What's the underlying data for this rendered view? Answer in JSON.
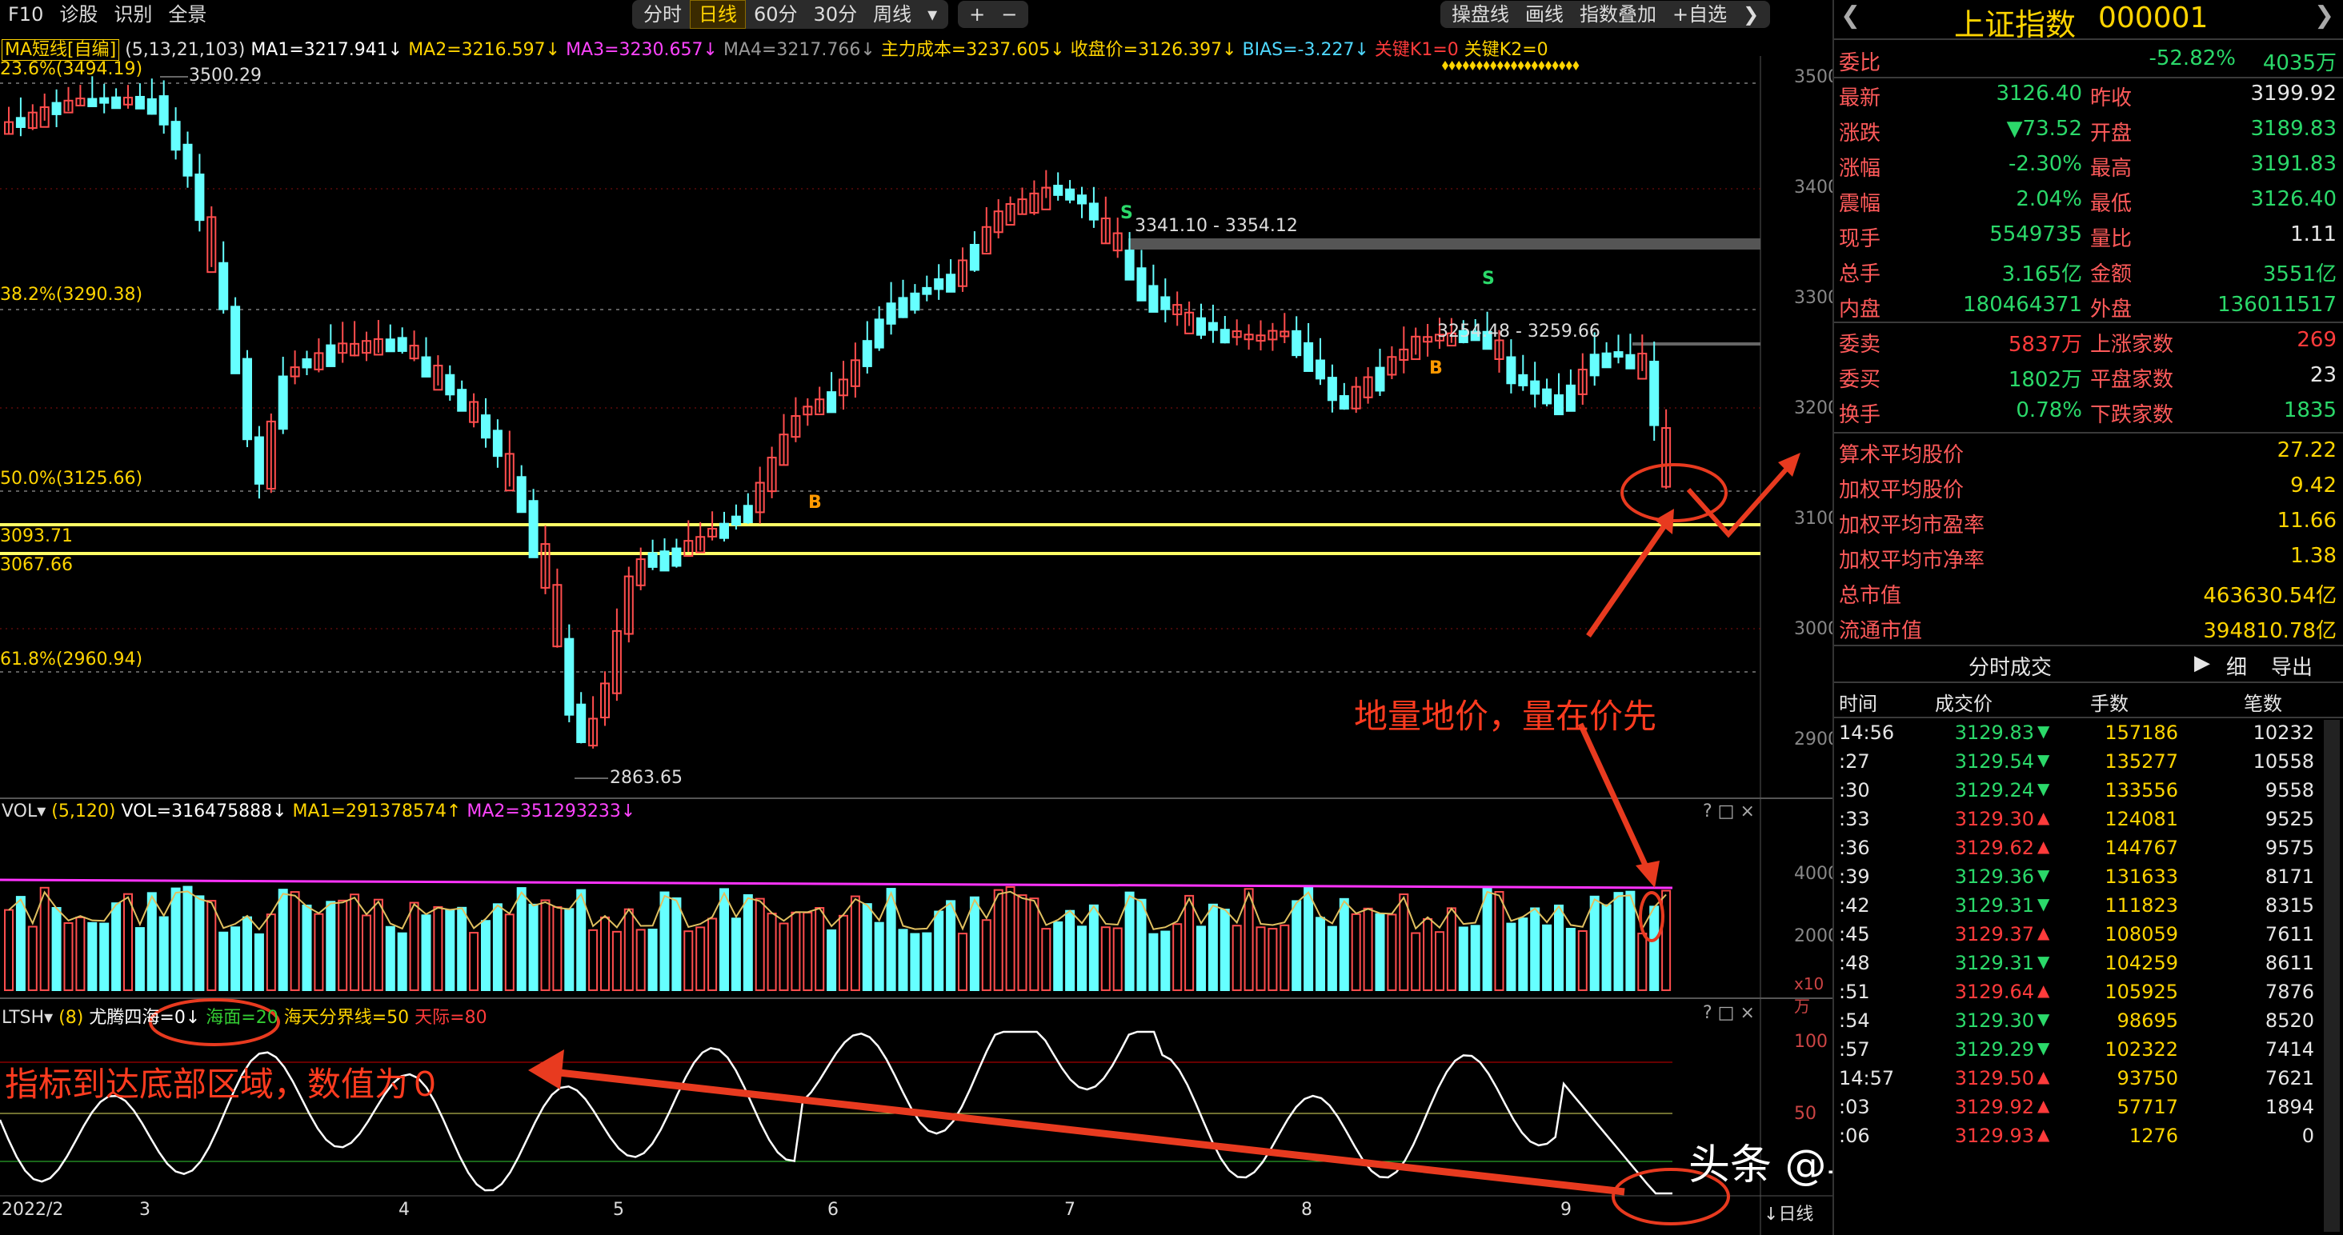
{
  "toolbar": {
    "f10": "F10",
    "diagnose": "诊股",
    "identify": "识别",
    "full": "全景",
    "period_tabs": [
      "分时",
      "日线",
      "60分",
      "30分",
      "周线"
    ],
    "period_active": "日线",
    "plus": "+",
    "minus": "−",
    "draw_line": "操盘线",
    "draw": "画线",
    "index_overlay": "指数叠加",
    "self_select": "+自选"
  },
  "main_legend": {
    "ma_type": "MA短线[自编]",
    "params": "(5,13,21,103)",
    "ma1": "MA1=3217.941↓",
    "ma2": "MA2=3216.597↓",
    "ma3": "MA3=3230.657↓",
    "ma4": "MA4=3217.766↓",
    "cost": "主力成本=3237.605↓",
    "close": "收盘价=3126.397↓",
    "bias": "BIAS=-3.227↓",
    "k1": "关键K1=0",
    "k2": "关键K2=0"
  },
  "price_labels": {
    "fib236": "23.6%(3494.19)",
    "high": "3500.29",
    "fib382": "38.2%(3290.38)",
    "fib50": "50.0%(3125.66)",
    "l1": "3093.71",
    "l2": "3067.66",
    "fib618": "61.8%(2960.94)",
    "low": "2863.65",
    "range1": "3341.10 - 3354.12",
    "range2": "3254.48 - 3259.66"
  },
  "signals": {
    "s": "S",
    "b": "B"
  },
  "price_axis": [
    "3500",
    "3400",
    "3300",
    "3200",
    "3100",
    "3000",
    "2900"
  ],
  "vol_legend": {
    "name": "VOL▾",
    "params": "(5,120)",
    "vol": "VOL=316475888↓",
    "ma1": "MA1=291378574↑",
    "ma2": "MA2=351293233↓"
  },
  "vol_axis": [
    "4000",
    "2000"
  ],
  "vol_unit": "x10万",
  "ind_legend": {
    "name": "LTSH▾",
    "params": "(8)",
    "a": "尤腾四海=0↓",
    "b": "海面=20",
    "c": "海天分界线=50",
    "d": "天际=80"
  },
  "ind_axis": [
    "100",
    "50"
  ],
  "x_axis": [
    "2022/2",
    "3",
    "4",
    "5",
    "6",
    "7",
    "8",
    "9"
  ],
  "period_btn": "↓日线",
  "panel_btns": "? □ ×",
  "annotations": {
    "price_note": "地量地价，量在价先",
    "indicator_note": "指标到达底部区域，数值为０",
    "watermark": "头条 @乌龟狂奔追蜗牛"
  },
  "side": {
    "title": "上证指数",
    "code": "000001",
    "weibi_label": "委比",
    "weibi": "-52.82%",
    "weicha": "4035万",
    "rows_left": [
      {
        "label": "最新",
        "value": "3126.40"
      },
      {
        "label": "涨跌",
        "value": "▼73.52"
      },
      {
        "label": "涨幅",
        "value": "-2.30%"
      },
      {
        "label": "震幅",
        "value": "2.04%"
      },
      {
        "label": "现手",
        "value": "5549735"
      },
      {
        "label": "总手",
        "value": "3.165亿"
      },
      {
        "label": "内盘",
        "value": "180464371"
      }
    ],
    "rows_right": [
      {
        "label": "昨收",
        "value": "3199.92"
      },
      {
        "label": "开盘",
        "value": "3189.83"
      },
      {
        "label": "最高",
        "value": "3191.83"
      },
      {
        "label": "最低",
        "value": "3126.40"
      },
      {
        "label": "量比",
        "value": "1.11"
      },
      {
        "label": "金额",
        "value": "3551亿"
      },
      {
        "label": "外盘",
        "value": "136011517"
      }
    ],
    "rows2_left": [
      {
        "label": "委卖",
        "value": "5837万"
      },
      {
        "label": "委买",
        "value": "1802万"
      },
      {
        "label": "换手",
        "value": "0.78%"
      }
    ],
    "rows2_right": [
      {
        "label": "上涨家数",
        "value": "269"
      },
      {
        "label": "平盘家数",
        "value": "23"
      },
      {
        "label": "下跌家数",
        "value": "1835"
      }
    ],
    "stats": [
      {
        "label": "算术平均股价",
        "value": "27.22"
      },
      {
        "label": "加权平均股价",
        "value": "9.42"
      },
      {
        "label": "加权平均市盈率",
        "value": "11.66"
      },
      {
        "label": "加权平均市净率",
        "value": "1.38"
      },
      {
        "label": "总市值",
        "value": "463630.54亿"
      },
      {
        "label": "流通市值",
        "value": "394810.78亿"
      }
    ],
    "trades_title": "分时成交",
    "trades_btn_detail": "细",
    "trades_btn_export": "导出",
    "trade_headers": [
      "时间",
      "成交价",
      "手数",
      "笔数"
    ],
    "trades": [
      {
        "t": "14:56",
        "p": "3129.83",
        "d": "▼",
        "v": "157186",
        "n": "10232"
      },
      {
        "t": ":27",
        "p": "3129.54",
        "d": "▼",
        "v": "135277",
        "n": "10558"
      },
      {
        "t": ":30",
        "p": "3129.24",
        "d": "▼",
        "v": "133556",
        "n": "9558"
      },
      {
        "t": ":33",
        "p": "3129.30",
        "d": "▲",
        "v": "124081",
        "n": "9525"
      },
      {
        "t": ":36",
        "p": "3129.62",
        "d": "▲",
        "v": "144767",
        "n": "9575"
      },
      {
        "t": ":39",
        "p": "3129.36",
        "d": "▼",
        "v": "131633",
        "n": "8171"
      },
      {
        "t": ":42",
        "p": "3129.31",
        "d": "▼",
        "v": "111823",
        "n": "8315"
      },
      {
        "t": ":45",
        "p": "3129.37",
        "d": "▲",
        "v": "108059",
        "n": "7611"
      },
      {
        "t": ":48",
        "p": "3129.31",
        "d": "▼",
        "v": "104259",
        "n": "8611"
      },
      {
        "t": ":51",
        "p": "3129.64",
        "d": "▲",
        "v": "105925",
        "n": "7876"
      },
      {
        "t": ":54",
        "p": "3129.30",
        "d": "▼",
        "v": "98695",
        "n": "8520"
      },
      {
        "t": ":57",
        "p": "3129.29",
        "d": "▼",
        "v": "102322",
        "n": "7414"
      },
      {
        "t": "14:57",
        "p": "3129.50",
        "d": "▲",
        "v": "93750",
        "n": "7621"
      },
      {
        "t": ":03",
        "p": "3129.92",
        "d": "▲",
        "v": "57717",
        "n": "1894"
      },
      {
        "t": ":06",
        "p": "3129.93",
        "d": "▲",
        "v": "1276",
        "n": "0"
      }
    ]
  }
}
